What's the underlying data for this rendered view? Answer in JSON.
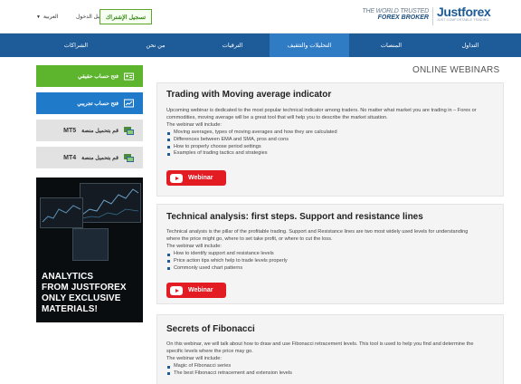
{
  "header": {
    "language": "العربية",
    "login": "تسجيل الدخول",
    "signup": "تسجيل الإشتراك",
    "tagline_line1": "THE WORLD TRUSTED",
    "tagline_line2": "FOREX BROKER",
    "logo_text": "Justforex",
    "logo_slogan": "JUST COMFORTABLE TRADING"
  },
  "nav": {
    "items": [
      {
        "label": "التداول"
      },
      {
        "label": "المنصات"
      },
      {
        "label": "التحليلات والتثقيف"
      },
      {
        "label": "الترقيات"
      },
      {
        "label": "من نحن"
      },
      {
        "label": "الشراكات"
      }
    ]
  },
  "sidebar": {
    "real_account": "فتح حساب حقيقي",
    "demo_account": "فتح حساب تجريبي",
    "mt5": "قم بتحميل منصة",
    "mt5_tag": "MT5",
    "mt4": "قم بتحميل منصة",
    "mt4_tag": "MT4",
    "promo_text": [
      "ANALYTICS",
      "FROM JUSTFOREX",
      "ONLY EXCLUSIVE",
      "MATERIALS!"
    ]
  },
  "main": {
    "heading": "ONLINE WEBINARS",
    "webinar_label": "Webinar",
    "cards": [
      {
        "title": "Trading with Moving average indicator",
        "desc": "Upcoming webinar is dedicated to the most popular technical indicator among traders. No matter what market you are trading in – Forex or commodities, moving average will be a great tool that will help you to describe the market situation.",
        "includes": "The webinar will include:",
        "items": [
          "Moving averages, types of moving averages and how they are calculated",
          "Differences between EMA and SMA, pros and cons",
          "How to properly choose period settings",
          "Examples of trading tactics and strategies"
        ]
      },
      {
        "title": "Technical analysis: first steps. Support and resistance lines",
        "desc": "Technical analysis is the pillar of the profitable trading. Support and Resistance lines are two most widely used levels for understanding where the price might go, where to set take profit, or where to cut the loss.",
        "includes": "The webinar will include:",
        "items": [
          "How to identify support and resistance levels",
          "Price action tips which help to trade levels properly",
          "Commonly used chart patterns"
        ]
      },
      {
        "title": "Secrets of Fibonacci",
        "desc": "On this webinar, we will talk about how to draw and use Fibonacci retracement levels. This tool is used to help you find and determine the specific levels where the price may go.",
        "includes": "The webinar will include:",
        "items": [
          "Magic of Fibonacci series",
          "The best Fibonacci retracement and extension levels"
        ]
      }
    ]
  },
  "colors": {
    "nav_bg": "#1e5c99",
    "nav_active": "#2f7bc4",
    "green": "#5db42d",
    "blue": "#1f7bc9",
    "webinar_red": "#e31c23"
  }
}
